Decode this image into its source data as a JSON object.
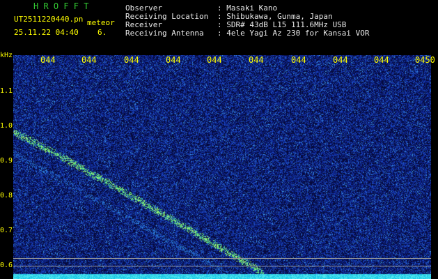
{
  "app": {
    "title": "H R O F F T",
    "file": "UT2511220440.pn",
    "mode": "meteor",
    "datetime": "25.11.22 04:40",
    "count": "6."
  },
  "info": [
    {
      "key": "Observer",
      "value": ": Masaki Kano"
    },
    {
      "key": "Receiving Location",
      "value": ": Shibukawa, Gunma, Japan"
    },
    {
      "key": "Receiver",
      "value": ": SDR# 43dB L15 111.6MHz USB"
    },
    {
      "key": "Receiving Antenna",
      "value": ": 4ele Yagi Az 230 for Kansai VOR"
    }
  ],
  "axis": {
    "unit": "kHz",
    "y_labels": [
      "1.1",
      "1.0",
      "0.9",
      "0.8",
      "0.7",
      "0.6"
    ],
    "time_labels": [
      "044",
      "044",
      "044",
      "044",
      "044",
      "044",
      "044",
      "044",
      "044",
      "0450"
    ]
  },
  "colors": {
    "background": "#000000",
    "noise": "#1a3fa8",
    "signal": "#9cff6a",
    "label_yellow": "#ffff00",
    "title_green": "#33cc33"
  }
}
